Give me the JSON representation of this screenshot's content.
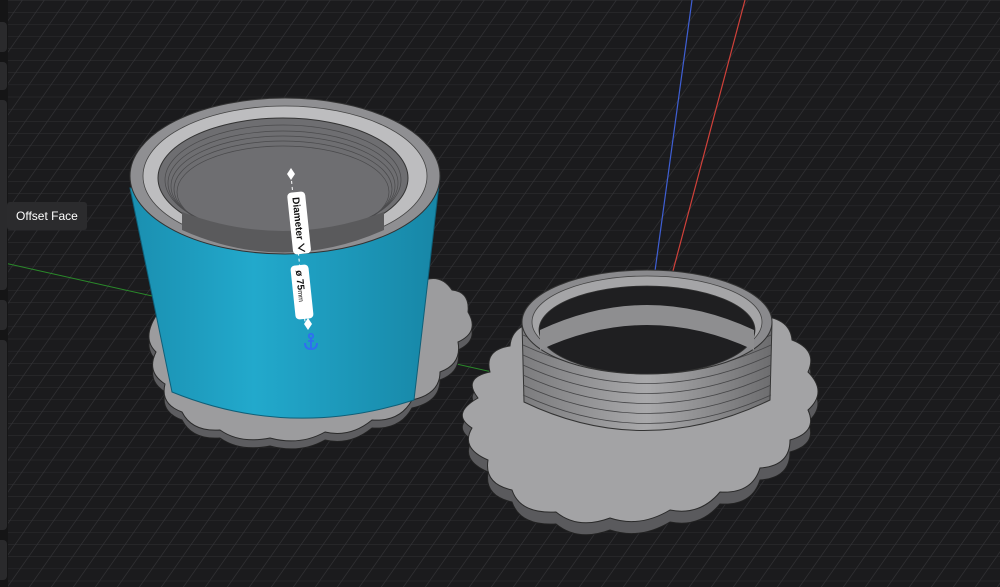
{
  "viewport": {
    "grid_color": "#2e2e30",
    "background": "#1b1b1d"
  },
  "axes": {
    "x_color": "#d0413a",
    "y_color": "#3f5fd4",
    "z_color": "#2a8a2a"
  },
  "parts": {
    "selected_color": "#1d9bbd",
    "body_color": "#a0a0a2"
  },
  "tooltip": {
    "label": "Offset Face"
  },
  "dimension": {
    "type_label": "Diameter",
    "value_label": "ø 75",
    "unit": "mm",
    "chevron_icon": "chevron-down-icon",
    "anchor_icon": "anchor-icon"
  }
}
